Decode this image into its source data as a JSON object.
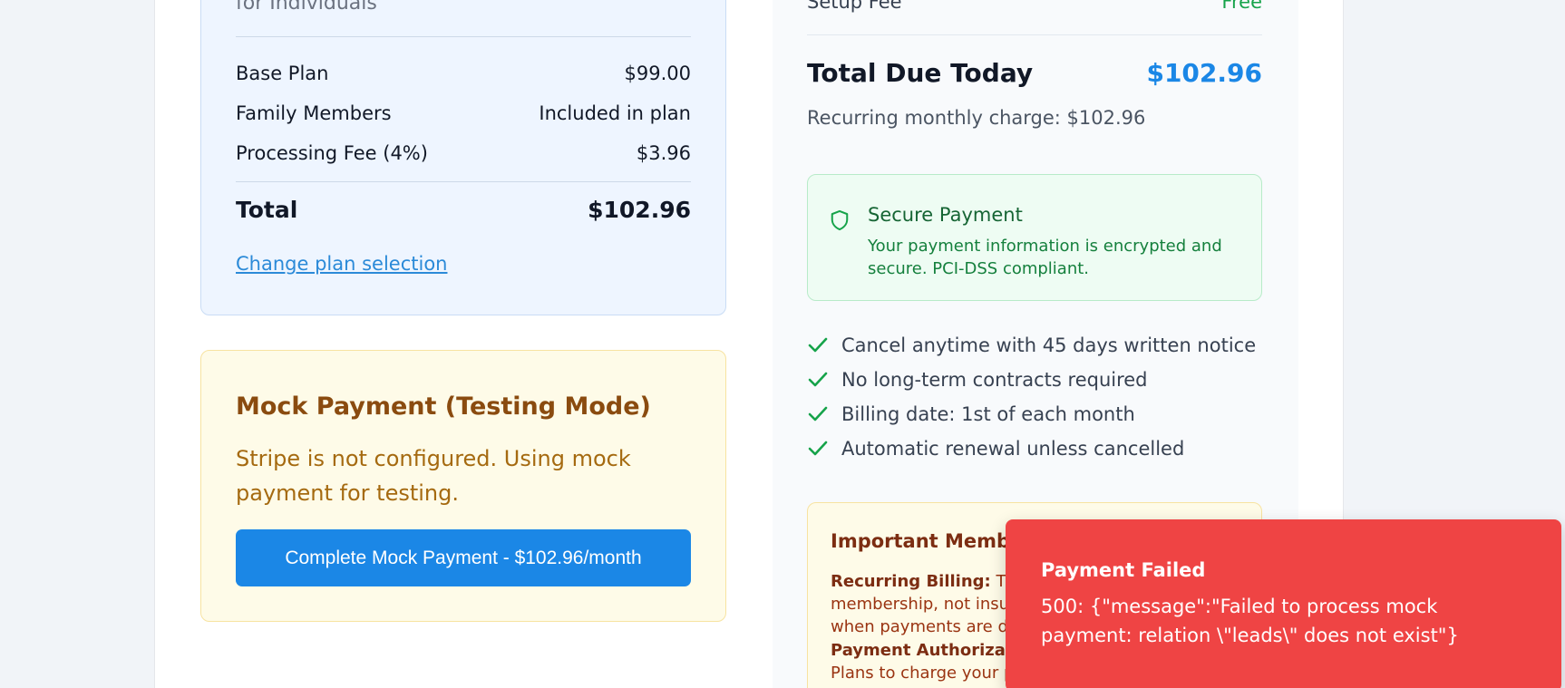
{
  "summary": {
    "subtitle": "for Individuals",
    "rows": [
      {
        "label": "Base Plan",
        "value": "$99.00"
      },
      {
        "label": "Family Members",
        "value": "Included in plan"
      },
      {
        "label": "Processing Fee (4%)",
        "value": "$3.96"
      }
    ],
    "total_label": "Total",
    "total_value": "$102.96",
    "change_link": "Change plan selection"
  },
  "mock_payment": {
    "title": "Mock Payment (Testing Mode)",
    "description": "Stripe is not configured. Using mock payment for testing.",
    "button_label": "Complete Mock Payment - $102.96/month"
  },
  "due": {
    "setup_label": "Setup Fee",
    "setup_value": "Free",
    "total_label": "Total Due Today",
    "total_value": "$102.96",
    "recurring": "Recurring monthly charge: $102.96"
  },
  "secure": {
    "title": "Secure Payment",
    "description": "Your payment information is encrypted and secure. PCI-DSS compliant.",
    "icon": "shield-icon"
  },
  "checks": [
    "Cancel anytime with 45 days written notice",
    "No long-term contracts required",
    "Billing date: 1st of each month",
    "Automatic renewal unless cancelled"
  ],
  "important": {
    "title": "Important Membership Information",
    "recurring_label": "Recurring Billing:",
    "recurring_text": " This is a recurring membership, not insurance. You are charged only when payments are due.",
    "auth_label": "Payment Authorization:",
    "auth_text": " I authorize My Premier Plans to charge your payment method on"
  },
  "toast": {
    "title": "Payment Failed",
    "message": "500: {\"message\":\"Failed to process mock payment: relation \\\"leads\\\" does not exist\"}"
  },
  "colors": {
    "accent": "#1b87e6",
    "success": "#16a34a",
    "error": "#ef4444",
    "warning_bg": "#fefbe8"
  }
}
